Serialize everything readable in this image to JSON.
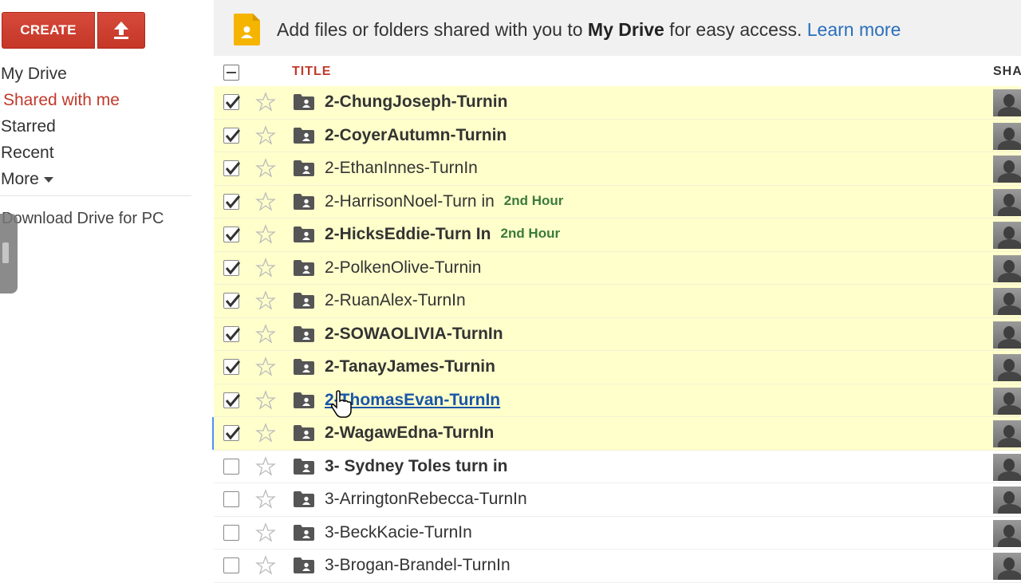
{
  "sidebar": {
    "create_label": "CREATE",
    "upload_icon": "upload-arrow-icon",
    "nav": [
      {
        "label": "My Drive",
        "active": false
      },
      {
        "label": "Shared with me",
        "active": true
      },
      {
        "label": "Starred",
        "active": false
      },
      {
        "label": "Recent",
        "active": false
      },
      {
        "label": "More",
        "active": false
      }
    ],
    "download_label": "Download Drive for PC"
  },
  "infobar": {
    "text_before": "Add files or folders shared with you to ",
    "text_bold": "My Drive",
    "text_after": " for easy access. ",
    "link": "Learn more"
  },
  "list": {
    "col_title": "TITLE",
    "col_shared": "SHA",
    "rows": [
      {
        "name": "2-ChungJoseph-Turnin",
        "tag": "",
        "checked": true,
        "bold": true
      },
      {
        "name": "2-CoyerAutumn-Turnin",
        "tag": "",
        "checked": true,
        "bold": true
      },
      {
        "name": "2-EthanInnes-TurnIn",
        "tag": "",
        "checked": true,
        "bold": false
      },
      {
        "name": "2-HarrisonNoel-Turn in",
        "tag": "2nd Hour",
        "checked": true,
        "bold": false
      },
      {
        "name": "2-HicksEddie-Turn In",
        "tag": "2nd Hour",
        "checked": true,
        "bold": true
      },
      {
        "name": "2-PolkenOlive-Turnin",
        "tag": "",
        "checked": true,
        "bold": false
      },
      {
        "name": "2-RuanAlex-TurnIn",
        "tag": "",
        "checked": true,
        "bold": false
      },
      {
        "name": "2-SOWAOLIVIA-TurnIn",
        "tag": "",
        "checked": true,
        "bold": true
      },
      {
        "name": "2-TanayJames-Turnin",
        "tag": "",
        "checked": true,
        "bold": true
      },
      {
        "name": "2-ThomasEvan-TurnIn",
        "tag": "",
        "checked": true,
        "bold": true
      },
      {
        "name": "2-WagawEdna-TurnIn",
        "tag": "",
        "checked": true,
        "bold": true
      },
      {
        "name": "3- Sydney Toles turn in",
        "tag": "",
        "checked": false,
        "bold": true
      },
      {
        "name": "3-ArringtonRebecca-TurnIn",
        "tag": "",
        "checked": false,
        "bold": false
      },
      {
        "name": "3-BeckKacie-TurnIn",
        "tag": "",
        "checked": false,
        "bold": false
      },
      {
        "name": "3-Brogan-Brandel-TurnIn",
        "tag": "",
        "checked": false,
        "bold": false
      }
    ]
  },
  "colors": {
    "accent_red": "#c1392b",
    "selected_row": "#ffffcc",
    "link_blue": "#2a6ebb",
    "tag_green": "#3b7a3b"
  }
}
